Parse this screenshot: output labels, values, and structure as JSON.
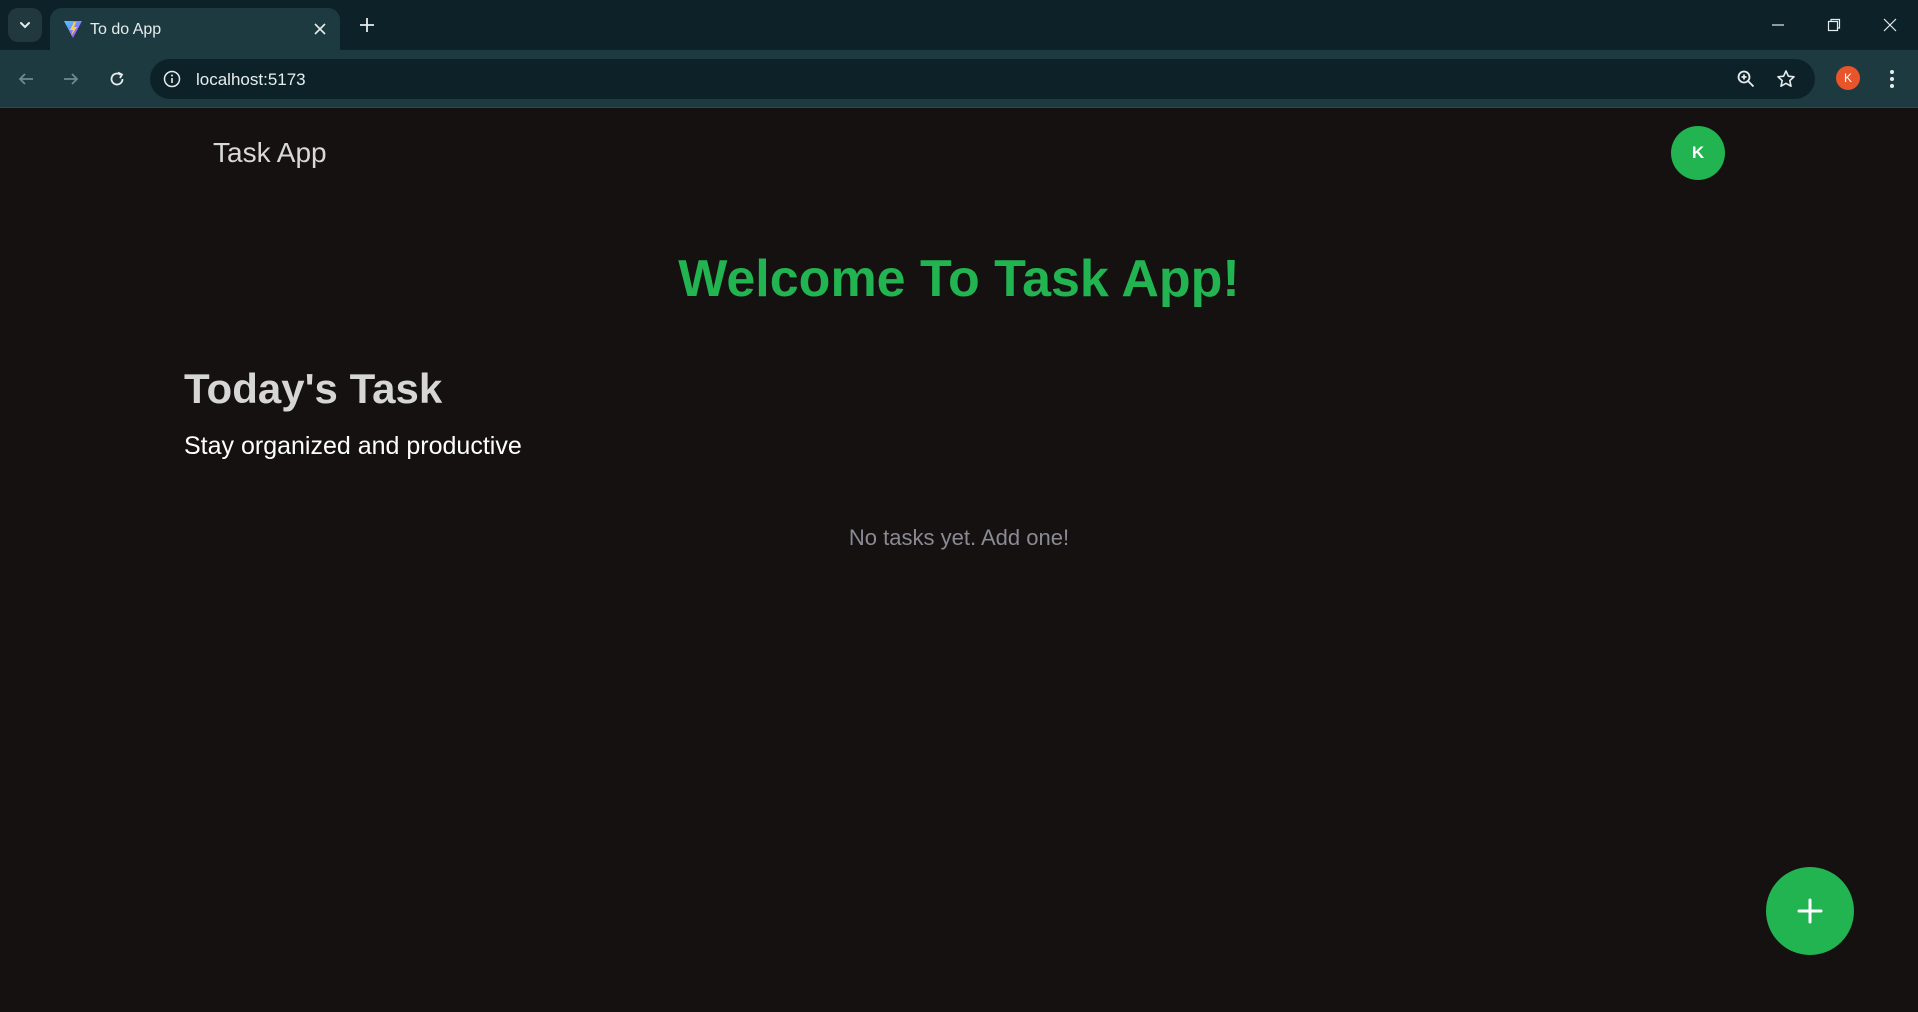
{
  "browser": {
    "tab_title": "To do App",
    "url": "localhost:5173",
    "profile_initial": "K"
  },
  "app": {
    "brand": "Task App",
    "user_initial": "K",
    "welcome": "Welcome To Task App!",
    "section_title": "Today's Task",
    "section_subtitle": "Stay organized and productive",
    "empty_message": "No tasks yet. Add one!"
  },
  "colors": {
    "accent": "#22b451",
    "background": "#151111",
    "chrome": "#0c2228",
    "toolbar": "#1d3a40",
    "profile": "#e8552a"
  },
  "icons": {
    "tab_menu": "chevron-down-icon",
    "favicon": "vite-logo-icon",
    "tab_close": "close-icon",
    "new_tab": "plus-icon",
    "back": "arrow-left-icon",
    "forward": "arrow-right-icon",
    "reload": "reload-icon",
    "site_info": "info-icon",
    "zoom": "zoom-icon",
    "bookmark": "star-icon",
    "menu": "kebab-menu-icon",
    "add_task": "plus-icon"
  }
}
